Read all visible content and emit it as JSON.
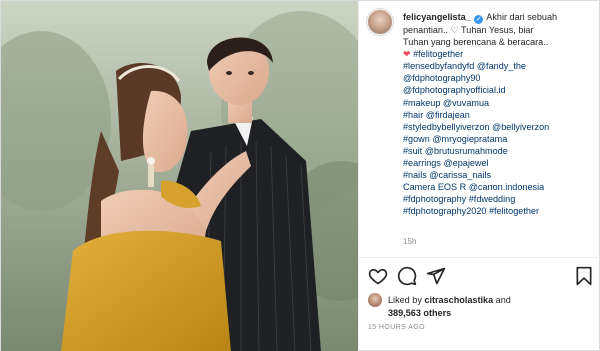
{
  "post": {
    "username": "felicyangelista_",
    "caption_lines": [
      "Akhir dari sebuah",
      "penantian.. ♡ Tuhan Yesus, biar",
      "Tuhan yang berencana & beracara.."
    ],
    "hashtag_lines": [
      "#felitogether",
      "#lensedbyfandyfd @fandy_the",
      "@fdphotography90",
      "@fdphotographyofficial.id",
      "#makeup @vuvamua",
      "#hair @firdajean",
      "#styledbybellyiverzon @bellyiverzon",
      "#gown @mryogiepratama",
      "#suit @brutusrumahmode",
      "#earrings @epajewel",
      "#nails @carissa_nails",
      "Camera EOS R @canon.indonesia",
      "#fdphotography #fdwedding",
      "#fdphotography2020 #felitogether"
    ],
    "comment_time": "15h",
    "liked_by_prefix": "Liked by ",
    "liked_by_user": "citrascholastika",
    "liked_by_and": " and",
    "likes_count": "389,563 others",
    "posted_ago": "15 HOURS AGO"
  },
  "colors": {
    "verified": "#3897f0",
    "heart": "#ed4956",
    "link": "#00376b"
  }
}
